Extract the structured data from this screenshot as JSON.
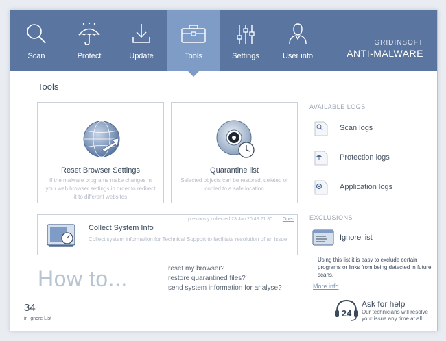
{
  "nav": {
    "items": [
      {
        "label": "Scan",
        "icon": "magnifier-icon"
      },
      {
        "label": "Protect",
        "icon": "umbrella-icon"
      },
      {
        "label": "Update",
        "icon": "download-icon"
      },
      {
        "label": "Tools",
        "icon": "briefcase-icon",
        "active": true
      },
      {
        "label": "Settings",
        "icon": "sliders-icon"
      },
      {
        "label": "User info",
        "icon": "user-icon"
      }
    ]
  },
  "brand": {
    "top": "GRIDINSOFT",
    "bottom": "ANTI-MALWARE"
  },
  "page_title": "Tools",
  "cards": {
    "reset": {
      "title": "Reset Browser Settings",
      "desc": "If the malware programs make changes in your web browser settings in order to redirect it to different websites"
    },
    "quarantine": {
      "title": "Quarantine list",
      "desc": "Selected objects can be restored, deleted or copied to a safe location"
    },
    "collect": {
      "title": "Collect System Info",
      "desc": "Collect system information for Technical Support to facilitate resolution of an issue",
      "meta": "previously collected 23 Jan 20:48 21:30",
      "meta_link": "Open"
    }
  },
  "logs": {
    "heading": "AVAILABLE LOGS",
    "items": [
      "Scan logs",
      "Protection logs",
      "Application logs"
    ]
  },
  "exclusions": {
    "heading": "EXCLUSIONS",
    "item": "Ignore list",
    "desc": "Using this list it is easy to exclude certain programs or links from being detected in future scans.",
    "more": "More info"
  },
  "howto": {
    "title": "How to...",
    "links": [
      "reset my browser?",
      "restore quarantined files?",
      "send system information for analyse?"
    ]
  },
  "ignore": {
    "count": "34",
    "label": "in Ignore List"
  },
  "help": {
    "badge": "24",
    "title": "Ask for help",
    "desc": "Our technicians will resolve your issue any time at all"
  },
  "colors": {
    "topbar": "#5a76a0",
    "active_tab": "#7f9cc6",
    "text": "#3b4a5c"
  }
}
